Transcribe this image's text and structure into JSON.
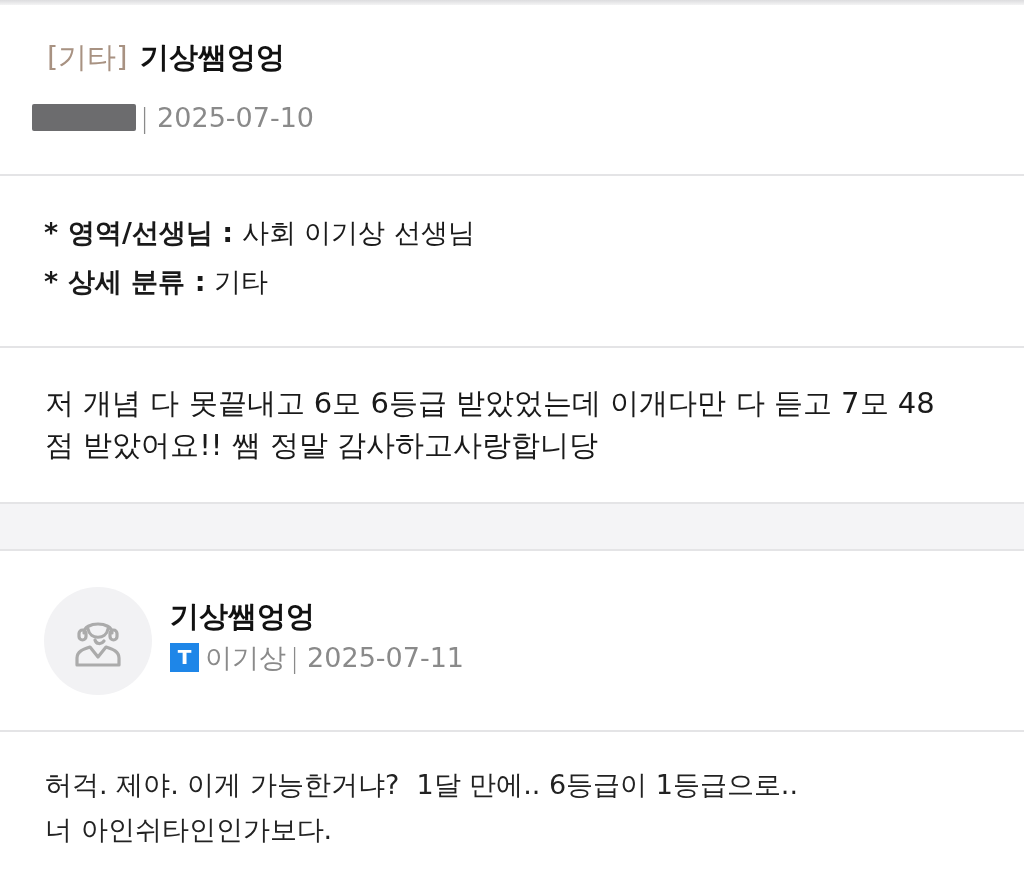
{
  "post": {
    "category": "[기타]",
    "title": "기상쌤엉엉",
    "author_redacted": true,
    "separator": "|",
    "date": "2025-07-10"
  },
  "details": [
    {
      "bullet": "*",
      "text": "**영역/선생님 :** 사회 이기상 선생님"
    },
    {
      "bullet": "*",
      "text": "**상세 분류 :** 기타"
    }
  ],
  "body": "저 개념 다 못끝내고 6모 6등급 받았었는데 이개다만 다 듣고 7모 48\n점 받았어요!! 쌤 정말 감사하고사랑합니당",
  "comments": [
    {
      "author_name": "기상쌤엉엉",
      "badge": "T",
      "author": "이기상",
      "separator": "|",
      "date": "2025-07-11",
      "text": "허걱. 제야. 이게 가능한거냐?  1달 만에.. 6등급이 1등급으로..\n너 아인쉬타인인가보다."
    }
  ]
}
